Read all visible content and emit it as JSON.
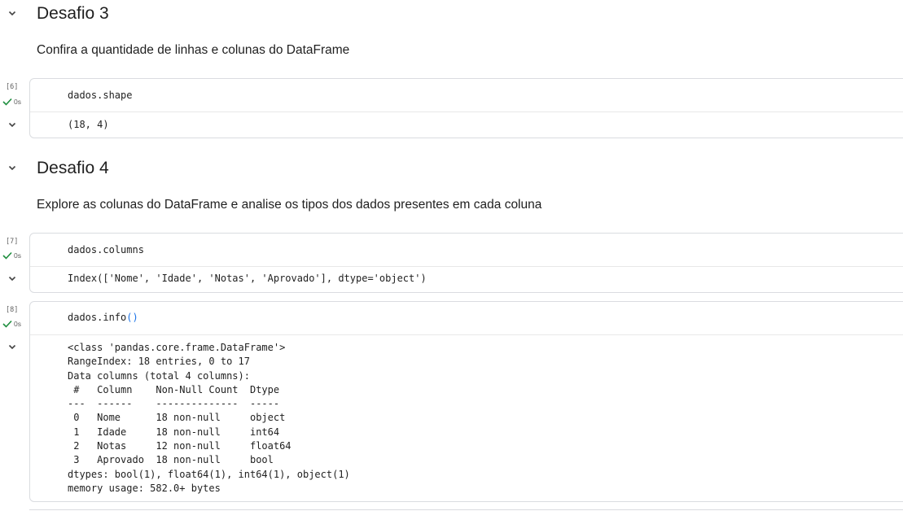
{
  "sections": [
    {
      "title": "Desafio 3",
      "description": "Confira a quantidade de linhas e colunas do DataFrame"
    },
    {
      "title": "Desafio 4",
      "description": "Explore as colunas do DataFrame e analise os tipos dos dados presentes em cada coluna"
    }
  ],
  "cells": [
    {
      "exec_count": "[6]",
      "status": "0s",
      "code_object": "dados.shape",
      "output": "(18, 4)"
    },
    {
      "exec_count": "[7]",
      "status": "0s",
      "code_object": "dados.columns",
      "output": "Index(['Nome', 'Idade', 'Notas', 'Aprovado'], dtype='object')"
    },
    {
      "exec_count": "[8]",
      "status": "0s",
      "code_object": "dados.info",
      "code_call": "()",
      "output": "<class 'pandas.core.frame.DataFrame'>\nRangeIndex: 18 entries, 0 to 17\nData columns (total 4 columns):\n #   Column    Non-Null Count  Dtype  \n---  ------    --------------  -----  \n 0   Nome      18 non-null     object \n 1   Idade     18 non-null     int64  \n 2   Notas     12 non-null     float64\n 3   Aprovado  18 non-null     bool   \ndtypes: bool(1), float64(1), int64(1), object(1)\nmemory usage: 582.0+ bytes"
    }
  ],
  "icons": {
    "section_chevron": "chevron-down-icon",
    "status_check": "check-icon",
    "output_chevron": "chevron-down-icon"
  },
  "colors": {
    "check": "#1e8e3e",
    "paren": "#1a73e8",
    "border": "#dadce0"
  }
}
